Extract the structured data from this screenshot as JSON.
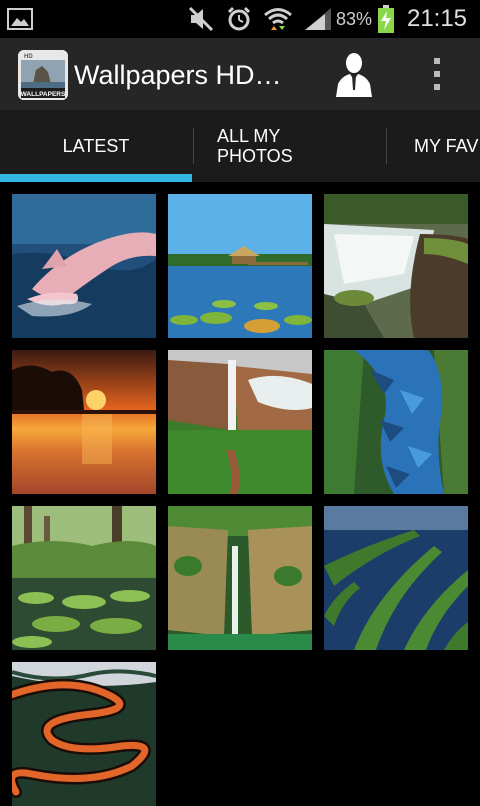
{
  "status_bar": {
    "battery_percent": "83%",
    "time": "21:15",
    "icons": [
      "image-notification-icon",
      "mute-icon",
      "alarm-icon",
      "wifi-icon",
      "signal-icon",
      "battery-charging-icon"
    ]
  },
  "action_bar": {
    "title": "Wallpapers HD…",
    "logo": {
      "top_text": "HD",
      "bottom_text": "WALLPAPERS"
    },
    "icons": [
      "app-logo-icon",
      "user-profile-icon",
      "overflow-menu-icon"
    ]
  },
  "tabs": [
    {
      "label": "LATEST",
      "selected": true
    },
    {
      "label_line1": "ALL MY",
      "label_line2": "PHOTOS",
      "selected": false
    },
    {
      "label": "MY FAV",
      "selected": false
    }
  ],
  "thumbnails": [
    {
      "subject": "pink river dolphin leaping"
    },
    {
      "subject": "water lilies and stilt hut on lake"
    },
    {
      "subject": "waterfall over rocks"
    },
    {
      "subject": "sunset over river"
    },
    {
      "subject": "tall waterfall from cliff into jungle"
    },
    {
      "subject": "blue butterflies on tree trunk"
    },
    {
      "subject": "giant lily pads in rainforest pond"
    },
    {
      "subject": "waterfall in green canyon"
    },
    {
      "subject": "aerial view of river islands"
    },
    {
      "subject": "aerial view of meandering orange river"
    }
  ],
  "colors": {
    "accent": "#33b5e5",
    "action_bar": "#262626",
    "tab_bar": "#1b1b1b",
    "battery_charge": "#8ad84a"
  }
}
